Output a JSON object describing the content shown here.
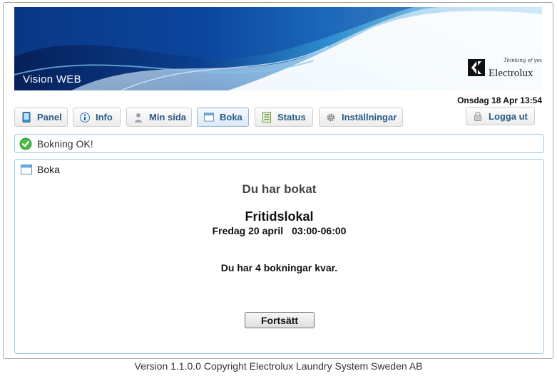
{
  "banner": {
    "title": "Vision WEB"
  },
  "logo": {
    "tagline": "Thinking of you",
    "word": "Electrolux"
  },
  "header": {
    "datetime": "Onsdag 18 Apr 13:54"
  },
  "nav": {
    "items": [
      {
        "label": "Panel",
        "icon": "tablet-icon"
      },
      {
        "label": "Info",
        "icon": "info-icon"
      },
      {
        "label": "Min sida",
        "icon": "user-icon"
      },
      {
        "label": "Boka",
        "icon": "calendar-icon",
        "active": true
      },
      {
        "label": "Status",
        "icon": "list-icon"
      },
      {
        "label": "Inställningar",
        "icon": "gear-icon"
      }
    ],
    "logout": {
      "label": "Logga ut",
      "icon": "lock-icon"
    }
  },
  "alert": {
    "message": "Bokning OK!",
    "icon": "check-circle-icon",
    "color": "#3aa53a"
  },
  "panel": {
    "title": "Boka",
    "heading": "Du har bokat",
    "resource": "Fritidslokal",
    "date": "Fredag 20 april",
    "time": "03:00-06:00",
    "remaining": "Du har 4 bokningar kvar.",
    "continue_label": "Fortsätt"
  },
  "footer": {
    "text": "Version 1.1.0.0 Copyright Electrolux Laundry System Sweden AB"
  },
  "colors": {
    "accent": "#2a5b8a",
    "border": "#9ccbe6"
  }
}
